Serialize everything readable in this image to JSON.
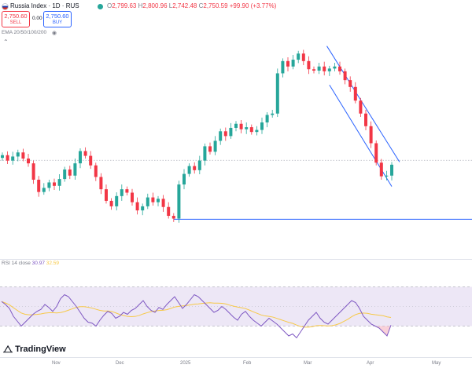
{
  "header": {
    "symbol_title": "Russia Index · 1D · RUS",
    "ohlc": {
      "o_label": "O",
      "o": "2,799.63",
      "h_label": "H",
      "h": "2,800.96",
      "l_label": "L",
      "l": "2,742.48",
      "c_label": "C",
      "c": "2,750.59",
      "change": "+99.90 (+3.77%)"
    },
    "sell": {
      "price": "2,750.60",
      "label": "SELL"
    },
    "spread": "0.00",
    "buy": {
      "price": "2,750.60",
      "label": "BUY"
    },
    "ema_label": "EMA 20/50/100/200"
  },
  "indicator": {
    "rsi_label": "RSI 14 close",
    "rsi_value": "30.97",
    "rsi_ma_value": "32.59"
  },
  "branding": {
    "logo_text": "TradingView"
  },
  "xaxis": {
    "ticks": [
      "Nov",
      "Dec",
      "2025",
      "Feb",
      "Mar",
      "Apr",
      "May"
    ]
  },
  "colors": {
    "up": "#26a69a",
    "down": "#f23645",
    "trendline": "#2962ff",
    "rsi_line": "#7e57c2",
    "rsi_ma": "#f7c948",
    "rsi_band": "#ede7f6"
  },
  "chart_data": {
    "type": "candlestick",
    "candles": [
      {
        "o": 2612,
        "c": 2620
      },
      {
        "o": 2620,
        "c": 2604
      },
      {
        "o": 2604,
        "c": 2616
      },
      {
        "o": 2616,
        "c": 2628
      },
      {
        "o": 2628,
        "c": 2610
      },
      {
        "o": 2610,
        "c": 2596
      },
      {
        "o": 2596,
        "c": 2548
      },
      {
        "o": 2548,
        "c": 2512
      },
      {
        "o": 2512,
        "c": 2524
      },
      {
        "o": 2524,
        "c": 2540
      },
      {
        "o": 2540,
        "c": 2530
      },
      {
        "o": 2530,
        "c": 2550
      },
      {
        "o": 2550,
        "c": 2578
      },
      {
        "o": 2578,
        "c": 2560
      },
      {
        "o": 2560,
        "c": 2596
      },
      {
        "o": 2596,
        "c": 2632
      },
      {
        "o": 2632,
        "c": 2618
      },
      {
        "o": 2618,
        "c": 2590
      },
      {
        "o": 2590,
        "c": 2556
      },
      {
        "o": 2556,
        "c": 2520
      },
      {
        "o": 2520,
        "c": 2486
      },
      {
        "o": 2486,
        "c": 2470
      },
      {
        "o": 2470,
        "c": 2500
      },
      {
        "o": 2500,
        "c": 2520
      },
      {
        "o": 2520,
        "c": 2510
      },
      {
        "o": 2510,
        "c": 2482
      },
      {
        "o": 2482,
        "c": 2458
      },
      {
        "o": 2458,
        "c": 2470
      },
      {
        "o": 2470,
        "c": 2496
      },
      {
        "o": 2496,
        "c": 2482
      },
      {
        "o": 2482,
        "c": 2492
      },
      {
        "o": 2492,
        "c": 2468
      },
      {
        "o": 2468,
        "c": 2442
      },
      {
        "o": 2442,
        "c": 2434
      },
      {
        "o": 2434,
        "c": 2534
      },
      {
        "o": 2534,
        "c": 2565
      },
      {
        "o": 2565,
        "c": 2588
      },
      {
        "o": 2588,
        "c": 2576
      },
      {
        "o": 2576,
        "c": 2604
      },
      {
        "o": 2604,
        "c": 2646
      },
      {
        "o": 2646,
        "c": 2630
      },
      {
        "o": 2630,
        "c": 2662
      },
      {
        "o": 2662,
        "c": 2690
      },
      {
        "o": 2690,
        "c": 2676
      },
      {
        "o": 2676,
        "c": 2700
      },
      {
        "o": 2700,
        "c": 2712
      },
      {
        "o": 2712,
        "c": 2696
      },
      {
        "o": 2696,
        "c": 2702
      },
      {
        "o": 2702,
        "c": 2688
      },
      {
        "o": 2688,
        "c": 2694
      },
      {
        "o": 2694,
        "c": 2716
      },
      {
        "o": 2716,
        "c": 2738
      },
      {
        "o": 2738,
        "c": 2742
      },
      {
        "o": 2742,
        "c": 2860
      },
      {
        "o": 2860,
        "c": 2896
      },
      {
        "o": 2896,
        "c": 2880
      },
      {
        "o": 2880,
        "c": 2900
      },
      {
        "o": 2900,
        "c": 2918
      },
      {
        "o": 2918,
        "c": 2896
      },
      {
        "o": 2896,
        "c": 2872
      },
      {
        "o": 2872,
        "c": 2868
      },
      {
        "o": 2868,
        "c": 2880
      },
      {
        "o": 2880,
        "c": 2866
      },
      {
        "o": 2866,
        "c": 2874
      },
      {
        "o": 2874,
        "c": 2880
      },
      {
        "o": 2880,
        "c": 2866
      },
      {
        "o": 2866,
        "c": 2840
      },
      {
        "o": 2840,
        "c": 2820
      },
      {
        "o": 2820,
        "c": 2780
      },
      {
        "o": 2780,
        "c": 2742
      },
      {
        "o": 2742,
        "c": 2705
      },
      {
        "o": 2705,
        "c": 2655
      },
      {
        "o": 2655,
        "c": 2598
      },
      {
        "o": 2598,
        "c": 2558
      },
      {
        "o": 2558,
        "c": 2560
      },
      {
        "o": 2560,
        "c": 2592
      }
    ],
    "trend_levels": [
      {
        "name": "support",
        "value": 2432
      },
      {
        "name": "prior_close",
        "value": 2605
      }
    ],
    "rsi": [
      55,
      52,
      48,
      40,
      35,
      30,
      34,
      38,
      42,
      45,
      47,
      52,
      49,
      45,
      50,
      58,
      62,
      60,
      55,
      50,
      44,
      38,
      34,
      33,
      30,
      36,
      41,
      45,
      43,
      38,
      40,
      44,
      42,
      46,
      48,
      52,
      56,
      50,
      46,
      44,
      49,
      47,
      52,
      56,
      60,
      54,
      48,
      52,
      57,
      62,
      60,
      56,
      52,
      48,
      44,
      46,
      50,
      47,
      43,
      39,
      36,
      42,
      45,
      40,
      36,
      33,
      30,
      34,
      38,
      35,
      32,
      28,
      24,
      20,
      22,
      18,
      24,
      30,
      36,
      40,
      44,
      38,
      34,
      32,
      36,
      40,
      44,
      48,
      52,
      56,
      54,
      48,
      40,
      36,
      32,
      30,
      28,
      24,
      20,
      31
    ]
  }
}
